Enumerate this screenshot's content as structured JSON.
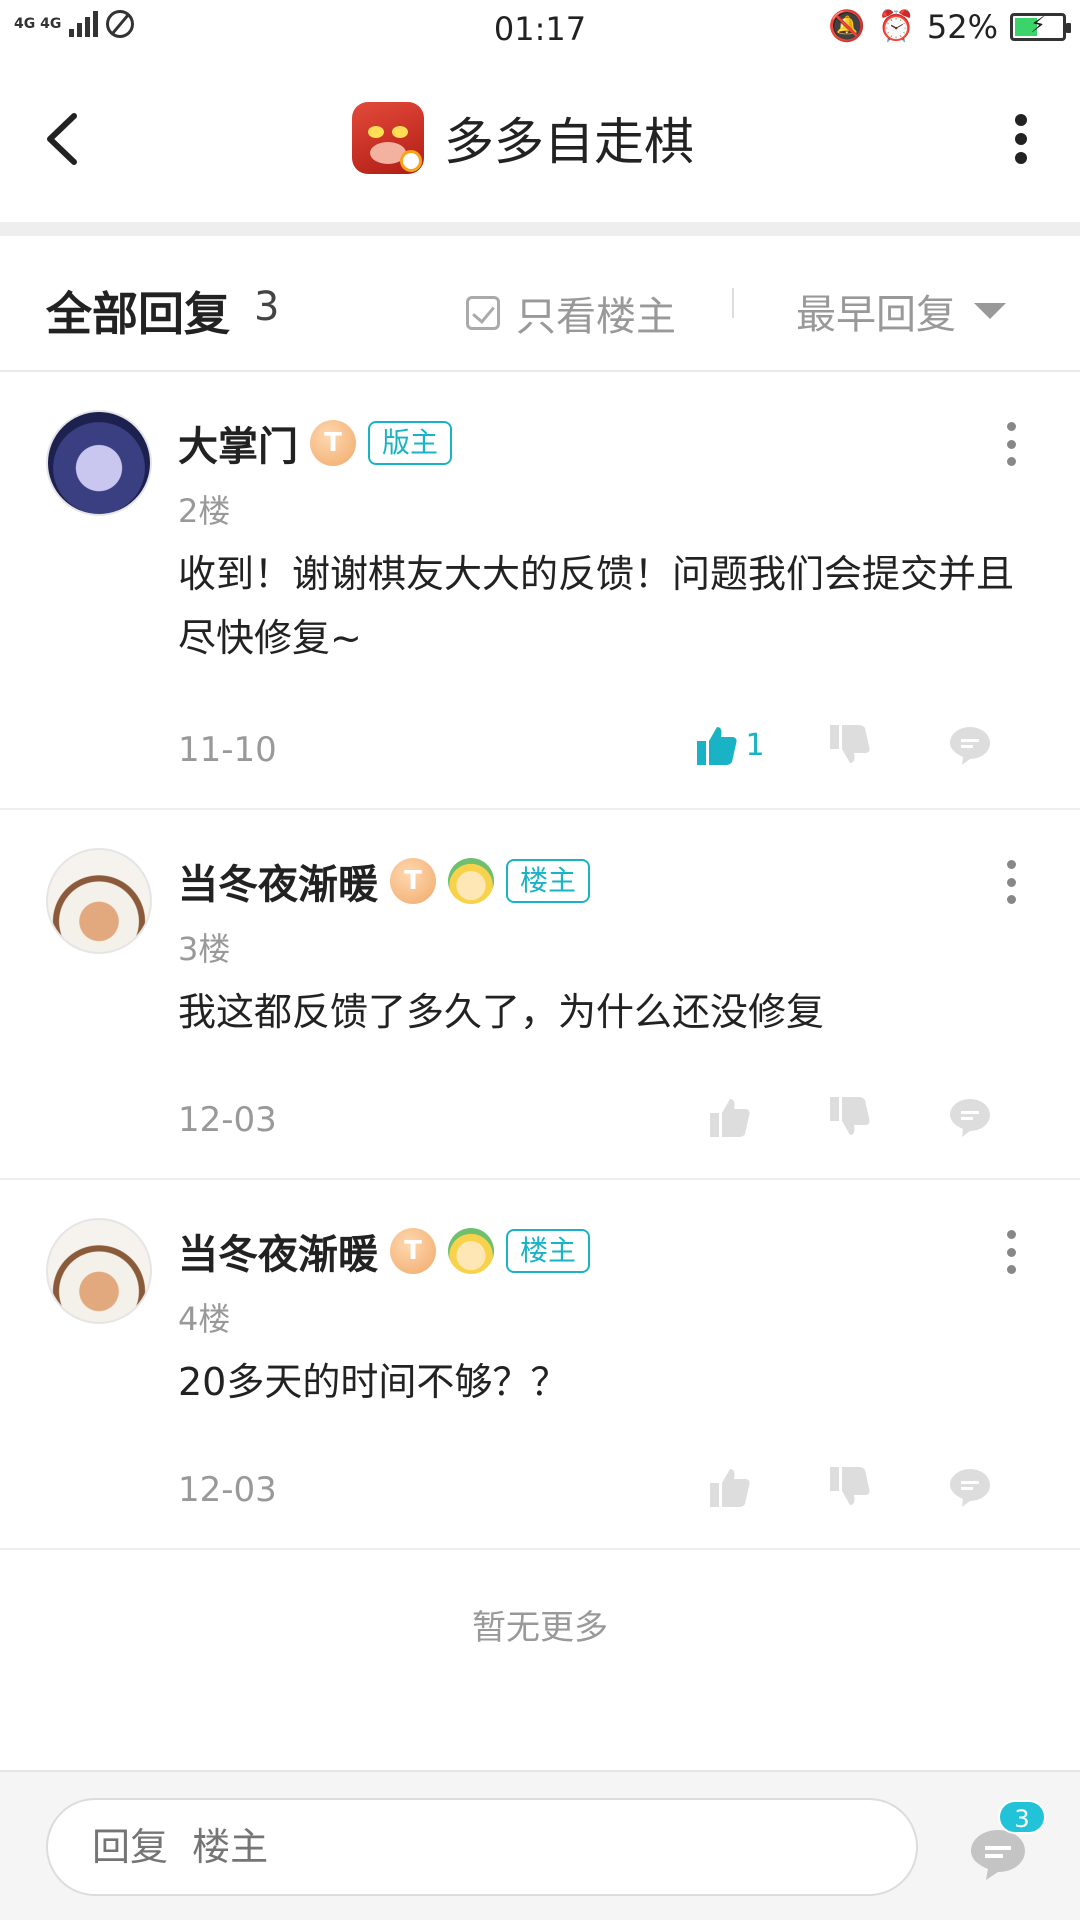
{
  "status_bar": {
    "network": "4G 4G",
    "time": "01:17",
    "battery_percent_text": "52%",
    "battery_level": 0.52
  },
  "header": {
    "title": "多多自走棋"
  },
  "filter": {
    "title": "全部回复",
    "count": "3",
    "only_op_label": "只看楼主",
    "sort_label": "最早回复"
  },
  "posts": [
    {
      "author": "大掌门",
      "level": "T",
      "role": "版主",
      "floor": "2楼",
      "content": "收到！谢谢棋友大大的反馈！问题我们会提交并且尽快修复~",
      "date": "11-10",
      "likes": "1",
      "liked": true
    },
    {
      "author": "当冬夜渐暖",
      "level": "T",
      "role": "楼主",
      "floor": "3楼",
      "content": "我这都反馈了多久了，为什么还没修复",
      "date": "12-03"
    },
    {
      "author": "当冬夜渐暖",
      "level": "T",
      "role": "楼主",
      "floor": "4楼",
      "content": "20多天的时间不够？？",
      "date": "12-03"
    }
  ],
  "no_more_text": "暂无更多",
  "bottom": {
    "reply_placeholder": "回复  楼主",
    "comment_count": "3"
  },
  "colors": {
    "accent": "#1ab3c6",
    "text_primary": "#222222",
    "text_secondary": "#999999",
    "icon_inactive": "#dddddd"
  }
}
